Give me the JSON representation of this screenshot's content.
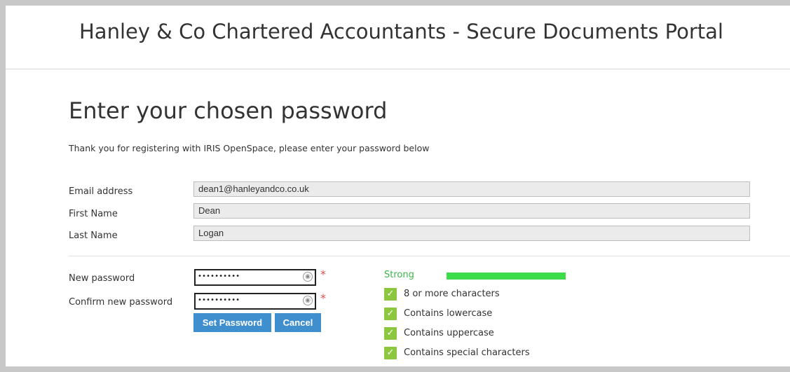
{
  "header": {
    "title": "Hanley & Co Chartered Accountants - Secure Documents Portal"
  },
  "page": {
    "heading": "Enter your chosen password",
    "intro": "Thank you for registering with IRIS OpenSpace, please enter your password below"
  },
  "fields": {
    "email": {
      "label": "Email address",
      "value": "dean1@hanleyandco.co.uk"
    },
    "first_name": {
      "label": "First Name",
      "value": "Dean"
    },
    "last_name": {
      "label": "Last Name",
      "value": "Logan"
    }
  },
  "password": {
    "new_label": "New password",
    "confirm_label": "Confirm new password",
    "new_value": "••••••••••",
    "confirm_value": "••••••••••",
    "required_mark": "*"
  },
  "buttons": {
    "set_password": "Set Password",
    "cancel": "Cancel"
  },
  "strength": {
    "label": "Strong",
    "level": 1.0,
    "color": "#3ddc4a",
    "checks": [
      {
        "text": "8 or more characters",
        "met": true
      },
      {
        "text": "Contains lowercase",
        "met": true
      },
      {
        "text": "Contains uppercase",
        "met": true
      },
      {
        "text": "Contains special characters",
        "met": true
      }
    ]
  }
}
